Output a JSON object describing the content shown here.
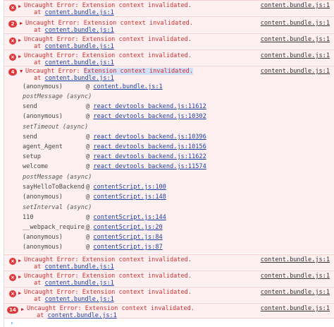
{
  "entries": [
    {
      "count": "",
      "message": "Uncaught Error: Extension context invalidated.",
      "at_prefix": "at ",
      "at_link": "content.bundle.js:1",
      "source": "content.bundle.js:1"
    },
    {
      "count": "2",
      "message": "Uncaught Error: Extension context invalidated.",
      "at_prefix": "at ",
      "at_link": "content.bundle.js:1",
      "source": "content.bundle.js:1"
    },
    {
      "count": "",
      "message": "Uncaught Error: Extension context invalidated.",
      "at_prefix": "at ",
      "at_link": "content.bundle.js:1",
      "source": "content.bundle.js:1"
    },
    {
      "count": "",
      "message": "Uncaught Error: Extension context invalidated.",
      "at_prefix": "at ",
      "at_link": "content.bundle.js:1",
      "source": "content.bundle.js:1"
    },
    {
      "count": "4",
      "message_prefix": "Uncaught Error: ",
      "message_highlight": "Extension context invalidated.",
      "at_prefix": "at ",
      "at_link": "content.bundle.js:1",
      "source": "content.bundle.js:1"
    },
    {
      "count": "",
      "message": "Uncaught Error: Extension context invalidated.",
      "at_prefix": "at ",
      "at_link": "content.bundle.js:1",
      "source": "content.bundle.js:1"
    },
    {
      "count": "",
      "message": "Uncaught Error: Extension context invalidated.",
      "at_prefix": "at ",
      "at_link": "content.bundle.js:1",
      "source": "content.bundle.js:1"
    },
    {
      "count": "",
      "message": "Uncaught Error: Extension context invalidated.",
      "at_prefix": "at ",
      "at_link": "content.bundle.js:1",
      "source": "content.bundle.js:1"
    },
    {
      "count": "14",
      "message": "Uncaught Error: Extension context invalidated.",
      "at_prefix": "at ",
      "at_link": "content.bundle.js:1",
      "source": "content.bundle.js:1"
    }
  ],
  "stack": [
    {
      "fn": "(anonymous)",
      "link": "content.bundle.js:1"
    },
    {
      "group": "postMessage (async)"
    },
    {
      "fn": "send",
      "link": "react_devtools_backend.js:11612"
    },
    {
      "fn": "(anonymous)",
      "link": "react_devtools_backend.js:10302"
    },
    {
      "group": "setTimeout (async)"
    },
    {
      "fn": "send",
      "link": "react_devtools_backend.js:10396"
    },
    {
      "fn": "agent_Agent",
      "link": "react_devtools_backend.js:10156"
    },
    {
      "fn": "setup",
      "link": "react_devtools_backend.js:11622"
    },
    {
      "fn": "welcome",
      "link": "react_devtools_backend.js:11574"
    },
    {
      "group": "postMessage (async)"
    },
    {
      "fn": "sayHelloToBackend",
      "link": "contentScript.js:100"
    },
    {
      "fn": "(anonymous)",
      "link": "contentScript.js:148"
    },
    {
      "group": "setInterval (async)"
    },
    {
      "fn": "110",
      "link": "contentScript.js:144"
    },
    {
      "fn": "__webpack_require__",
      "link": "contentScript.js:20"
    },
    {
      "fn": "(anonymous)",
      "link": "contentScript.js:84"
    },
    {
      "fn": "(anonymous)",
      "link": "contentScript.js:87"
    }
  ],
  "at_sign": "@",
  "prompt_symbol": "›",
  "icons": {
    "error": "error-icon",
    "expand": "triangle-right-icon",
    "collapse": "triangle-down-icon"
  }
}
